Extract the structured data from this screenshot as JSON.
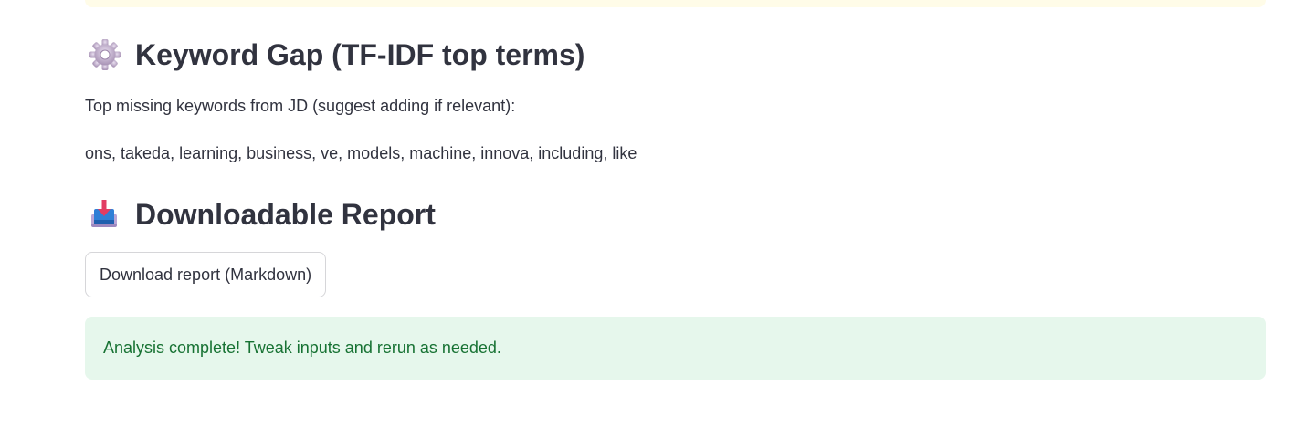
{
  "sections": {
    "keyword_gap": {
      "title": "Keyword Gap (TF-IDF top terms)",
      "icon": "gear-icon",
      "intro": "Top missing keywords from JD (suggest adding if relevant):",
      "keywords": "ons, takeda, learning, business, ve, models, machine, innova, including, like"
    },
    "report": {
      "title": "Downloadable Report",
      "icon": "inbox-download-icon",
      "download_label": "Download report (Markdown)"
    }
  },
  "status": {
    "message": "Analysis complete! Tweak inputs and rerun as needed."
  },
  "colors": {
    "text": "#31333f",
    "success_bg": "#e6f7ec",
    "success_text": "#177233",
    "warning_bg": "#fffce8"
  }
}
